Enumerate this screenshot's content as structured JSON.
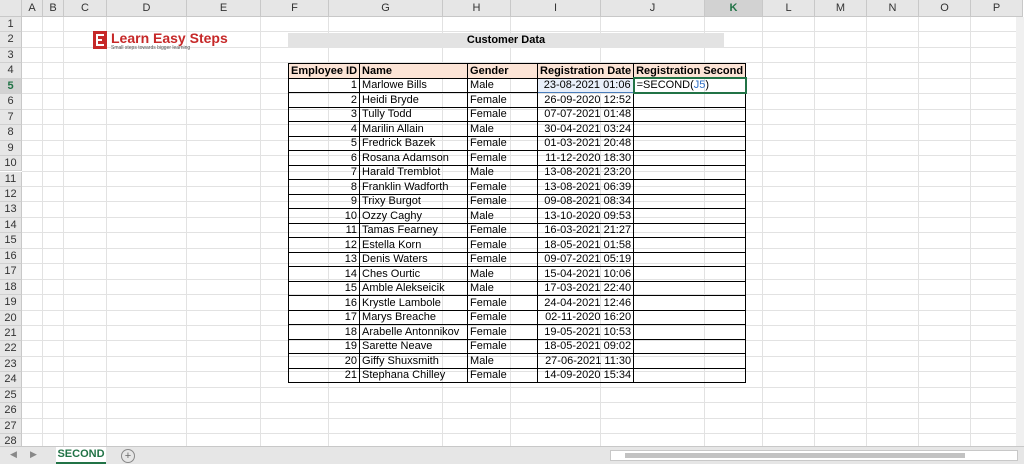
{
  "columns": [
    "A",
    "B",
    "C",
    "D",
    "E",
    "F",
    "G",
    "H",
    "I",
    "J",
    "K",
    "L",
    "M",
    "N",
    "O",
    "P"
  ],
  "rows": [
    "1",
    "2",
    "3",
    "4",
    "5",
    "6",
    "7",
    "8",
    "9",
    "10",
    "11",
    "12",
    "13",
    "14",
    "15",
    "16",
    "17",
    "18",
    "19",
    "20",
    "21",
    "22",
    "23",
    "24",
    "25",
    "26",
    "27",
    "28"
  ],
  "logo": {
    "name": "Learn Easy Steps",
    "tagline": "Small steps towards bigger learning"
  },
  "title": "Customer Data",
  "headers": [
    "Employee ID",
    "Name",
    "Gender",
    "Registration Date",
    "Registration Second"
  ],
  "records": [
    {
      "id": "1",
      "name": "Marlowe Bills",
      "gender": "Male",
      "date": "23-08-2021 01:06"
    },
    {
      "id": "2",
      "name": "Heidi Bryde",
      "gender": "Female",
      "date": "26-09-2020 12:52"
    },
    {
      "id": "3",
      "name": "Tully Todd",
      "gender": "Female",
      "date": "07-07-2021 01:48"
    },
    {
      "id": "4",
      "name": "Marilin Allain",
      "gender": "Male",
      "date": "30-04-2021 03:24"
    },
    {
      "id": "5",
      "name": "Fredrick Bazek",
      "gender": "Female",
      "date": "01-03-2021 20:48"
    },
    {
      "id": "6",
      "name": "Rosana Adamson",
      "gender": "Female",
      "date": "11-12-2020 18:30"
    },
    {
      "id": "7",
      "name": "Harald Tremblot",
      "gender": "Male",
      "date": "13-08-2021 23:20"
    },
    {
      "id": "8",
      "name": "Franklin Wadforth",
      "gender": "Female",
      "date": "13-08-2021 06:39"
    },
    {
      "id": "9",
      "name": "Trixy Burgot",
      "gender": "Female",
      "date": "09-08-2021 08:34"
    },
    {
      "id": "10",
      "name": "Ozzy Caghy",
      "gender": "Male",
      "date": "13-10-2020 09:53"
    },
    {
      "id": "11",
      "name": "Tamas Fearney",
      "gender": "Female",
      "date": "16-03-2021 21:27"
    },
    {
      "id": "12",
      "name": "Estella Korn",
      "gender": "Female",
      "date": "18-05-2021 01:58"
    },
    {
      "id": "13",
      "name": "Denis Waters",
      "gender": "Female",
      "date": "09-07-2021 05:19"
    },
    {
      "id": "14",
      "name": "Ches Ourtic",
      "gender": "Male",
      "date": "15-04-2021 10:06"
    },
    {
      "id": "15",
      "name": "Amble Alekseicik",
      "gender": "Male",
      "date": "17-03-2021 22:40"
    },
    {
      "id": "16",
      "name": "Krystle Lambole",
      "gender": "Female",
      "date": "24-04-2021 12:46"
    },
    {
      "id": "17",
      "name": "Marys Breache",
      "gender": "Female",
      "date": "02-11-2020 16:20"
    },
    {
      "id": "18",
      "name": "Arabelle Antonnikov",
      "gender": "Female",
      "date": "19-05-2021 10:53"
    },
    {
      "id": "19",
      "name": "Sarette Neave",
      "gender": "Female",
      "date": "18-05-2021 09:02"
    },
    {
      "id": "20",
      "name": "Giffy Shuxsmith",
      "gender": "Male",
      "date": "27-06-2021 11:30"
    },
    {
      "id": "21",
      "name": "Stephana Chilley",
      "gender": "Female",
      "date": "14-09-2020 15:34"
    }
  ],
  "formula": {
    "prefix": "=SECOND(",
    "ref": "J5",
    "suffix": ")"
  },
  "sheet_tab": "SECOND",
  "add_sheet": "+",
  "colors": {
    "header_fill": "#fce4d6",
    "accent": "#217346",
    "ref": "#2f6fc6",
    "logo": "#c62828"
  }
}
